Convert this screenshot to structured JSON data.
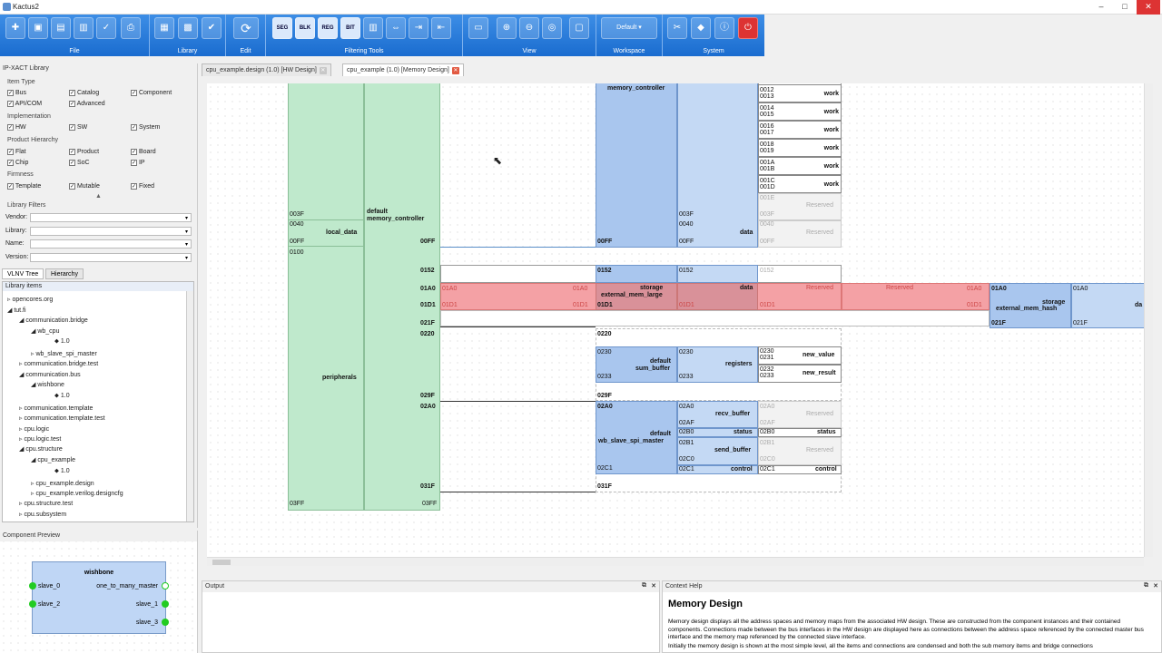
{
  "window": {
    "title": "Kactus2",
    "min": "–",
    "max": "□",
    "close": "✕"
  },
  "ribbon": {
    "groups": [
      {
        "label": "File"
      },
      {
        "label": "Library"
      },
      {
        "label": "Edit"
      },
      {
        "label": "Filtering Tools"
      },
      {
        "label": "View"
      },
      {
        "label": "Workspace"
      },
      {
        "label": "System"
      }
    ],
    "filter_buttons": [
      "SEG",
      "BLK",
      "REG",
      "BIT"
    ],
    "workspace_value": "Default"
  },
  "tabs": [
    {
      "label": "cpu_example.design (1.0) [HW Design]"
    },
    {
      "label": "cpu_example (1.0) [Memory Design]"
    }
  ],
  "library": {
    "title": "IP-XACT Library",
    "item_type": "Item Type",
    "cb_bus": "Bus",
    "cb_catalog": "Catalog",
    "cb_component": "Component",
    "cb_apicom": "API/COM",
    "cb_advanced": "Advanced",
    "implementation": "Implementation",
    "cb_hw": "HW",
    "cb_sw": "SW",
    "cb_system": "System",
    "product_hierarchy": "Product Hierarchy",
    "cb_flat": "Flat",
    "cb_product": "Product",
    "cb_board": "Board",
    "cb_chip": "Chip",
    "cb_soc": "SoC",
    "cb_ip": "IP",
    "firmness": "Firmness",
    "cb_template": "Template",
    "cb_mutable": "Mutable",
    "cb_fixed": "Fixed",
    "filters": "Library Filters",
    "vendor": "Vendor:",
    "library": "Library:",
    "name": "Name:",
    "version": "Version:",
    "tab_vlnv": "VLNV Tree",
    "tab_hierarchy": "Hierarchy",
    "items_header": "Library items",
    "tree": [
      "opencores.org",
      "tut.fi",
      "communication.bridge",
      "wb_cpu",
      "1.0",
      "wb_slave_spi_master",
      "communication.bridge.test",
      "communication.bus",
      "wishbone",
      "1.0",
      "communication.template",
      "communication.template.test",
      "cpu.logic",
      "cpu.logic.test",
      "cpu.structure",
      "cpu_example",
      "1.0",
      "cpu_example.design",
      "cpu_example.verilog.designcfg",
      "cpu.structure.test",
      "cpu.subsystem"
    ]
  },
  "preview": {
    "title": "Component Preview",
    "component": "wishbone",
    "ports": [
      "slave_0",
      "slave_2",
      "one_to_many_master",
      "slave_1",
      "slave_3"
    ]
  },
  "output": {
    "title": "Output"
  },
  "help": {
    "title": "Context Help",
    "heading": "Memory Design",
    "body": "Memory design displays all the address spaces and memory maps from the associated HW design. These are constructed from the component instances and their contained components. Connections made between the bus interfaces in the HW design are displayed here as connections between the address space referenced by the connected master bus interface and the memory map referenced by the connected slave interface.",
    "body2": "Initially the memory design is shown at the most simple level, all the items and connections are condensed and both the sub memory items and bridge connections"
  },
  "memory": {
    "as_col1": {
      "a003F": "003F",
      "a0040": "0040",
      "a00FF": "00FF",
      "a0100": "0100",
      "a03FF": "03FF",
      "local": "local_data",
      "periph": "peripherals"
    },
    "as_col2": {
      "name1": "default",
      "name2": "memory_controller",
      "a00FF": "00FF",
      "a0152": "0152",
      "a01A0": "01A0",
      "a01D1": "01D1",
      "a021F": "021F",
      "a0220": "0220",
      "a029F": "029F",
      "a02A0": "02A0",
      "a031F": "031F",
      "a03FF": "03FF"
    },
    "mc": {
      "name": "memory_controller",
      "a003F": "003F",
      "a0040": "0040",
      "a00FF": "00FF",
      "a00FF2": "00FF",
      "data": "data",
      "work": [
        [
          "0012",
          "0013"
        ],
        [
          "0014",
          "0015"
        ],
        [
          "0016",
          "0017"
        ],
        [
          "0018",
          "0019"
        ],
        [
          "001A",
          "001B"
        ],
        [
          "001C",
          "001D"
        ]
      ],
      "work_label": "work",
      "reserved": "Reserved",
      "r1": "001E",
      "r2": "003F",
      "r3": "0040",
      "r4": "00FF"
    },
    "ext": {
      "a0152": "0152",
      "a0152b": "0152",
      "a0152c": "0152",
      "a01A0": "01A0",
      "a01D1": "01D1",
      "storage": "storage",
      "name": "external_mem_large",
      "data": "data",
      "reserved": "Reserved",
      "hash": "external_mem_hash",
      "a021F": "021F",
      "da": "da"
    },
    "sum": {
      "a0220": "0220",
      "a0230": "0230",
      "a0233": "0233",
      "name1": "default",
      "name2": "sum_buffer",
      "registers": "registers",
      "a0230b": "0230",
      "a0233b": "0233",
      "nv": "new_value",
      "nr": "new_result",
      "r0230": "0230",
      "r0231": "0231",
      "r0232": "0232",
      "r0233": "0233",
      "a029F": "029F"
    },
    "spi": {
      "a02A0": "02A0",
      "name1": "default",
      "name2": "wb_slave_spi_master",
      "a02C1": "02C1",
      "a031F": "031F",
      "recv": "recv_buffer",
      "status": "status",
      "send": "send_buffer",
      "control": "control",
      "o02A0": "02A0",
      "o02AF": "02AF",
      "o02B0": "02B0",
      "o02B1": "02B1",
      "o02C0": "02C0",
      "o02C1": "02C1",
      "r02A0": "02A0",
      "r02AF": "02AF",
      "r02B0": "02B0",
      "r02B1": "02B1",
      "r02C0": "02C0",
      "r02C1": "02C1"
    }
  }
}
